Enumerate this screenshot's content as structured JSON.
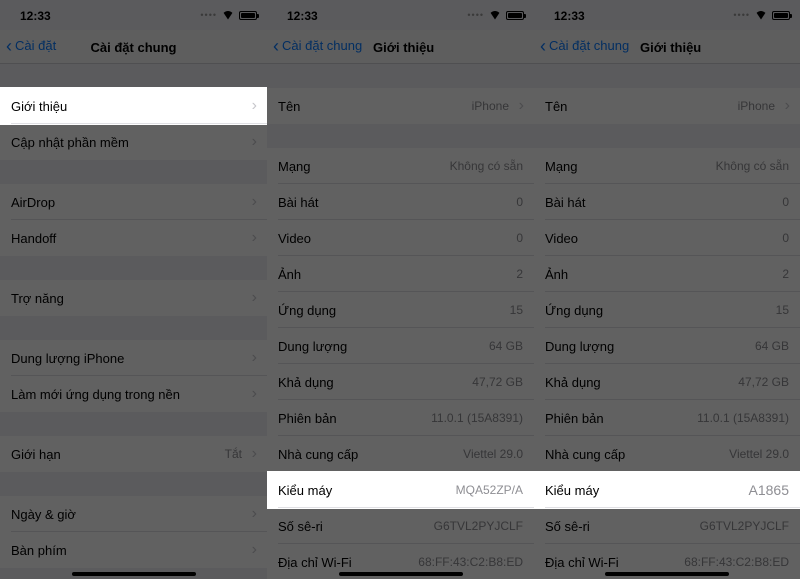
{
  "status": {
    "time": "12:33"
  },
  "screen1": {
    "back": "Cài đặt",
    "title": "Cài đặt chung",
    "groups": [
      [
        {
          "label": "Giới thiệu",
          "highlight": true
        },
        {
          "label": "Cập nhật phần mềm"
        }
      ],
      [
        {
          "label": "AirDrop"
        },
        {
          "label": "Handoff"
        }
      ],
      [
        {
          "label": "Trợ năng"
        }
      ],
      [
        {
          "label": "Dung lượng iPhone"
        },
        {
          "label": "Làm mới ứng dụng trong nền"
        }
      ],
      [
        {
          "label": "Giới hạn",
          "value": "Tắt"
        }
      ],
      [
        {
          "label": "Ngày & giờ"
        },
        {
          "label": "Bàn phím"
        }
      ]
    ]
  },
  "screen2": {
    "back": "Cài đặt chung",
    "title": "Giới thiệu",
    "groups": [
      [
        {
          "label": "Tên",
          "value": "iPhone",
          "arrow": true
        }
      ],
      [
        {
          "label": "Mạng",
          "value": "Không có sẵn"
        },
        {
          "label": "Bài hát",
          "value": "0"
        },
        {
          "label": "Video",
          "value": "0"
        },
        {
          "label": "Ảnh",
          "value": "2"
        },
        {
          "label": "Ứng dụng",
          "value": "15"
        },
        {
          "label": "Dung lượng",
          "value": "64 GB"
        },
        {
          "label": "Khả dụng",
          "value": "47,72 GB"
        },
        {
          "label": "Phiên bản",
          "value": "11.0.1 (15A8391)"
        },
        {
          "label": "Nhà cung cấp",
          "value": "Viettel 29.0"
        },
        {
          "label": "Kiểu máy",
          "value": "MQA52ZP/A",
          "highlight": true
        },
        {
          "label": "Số sê-ri",
          "value": "G6TVL2PYJCLF"
        },
        {
          "label": "Địa chỉ Wi-Fi",
          "value": "68:FF:43:C2:B8:ED"
        }
      ]
    ]
  },
  "screen3": {
    "back": "Cài đặt chung",
    "title": "Giới thiệu",
    "groups": [
      [
        {
          "label": "Tên",
          "value": "iPhone",
          "arrow": true
        }
      ],
      [
        {
          "label": "Mạng",
          "value": "Không có sẵn"
        },
        {
          "label": "Bài hát",
          "value": "0"
        },
        {
          "label": "Video",
          "value": "0"
        },
        {
          "label": "Ảnh",
          "value": "2"
        },
        {
          "label": "Ứng dụng",
          "value": "15"
        },
        {
          "label": "Dung lượng",
          "value": "64 GB"
        },
        {
          "label": "Khả dụng",
          "value": "47,72 GB"
        },
        {
          "label": "Phiên bản",
          "value": "11.0.1 (15A8391)"
        },
        {
          "label": "Nhà cung cấp",
          "value": "Viettel 29.0"
        },
        {
          "label": "Kiểu máy",
          "value": "A1865",
          "highlight": true
        },
        {
          "label": "Số sê-ri",
          "value": "G6TVL2PYJCLF"
        },
        {
          "label": "Địa chỉ Wi-Fi",
          "value": "68:FF:43:C2:B8:ED"
        }
      ]
    ]
  }
}
